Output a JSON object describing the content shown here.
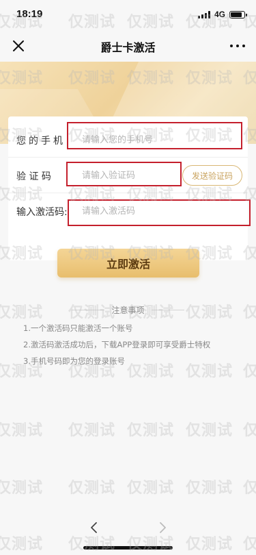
{
  "status_bar": {
    "time": "18:19",
    "network": "4G"
  },
  "nav": {
    "title": "爵士卡激活"
  },
  "form": {
    "phone_label": "您的手机",
    "phone_placeholder": "请输入您的手机号",
    "code_label": "验 证 码",
    "code_placeholder": "请输入验证码",
    "send_code_label": "发送验证码",
    "activation_label": "输入激活码:",
    "activation_placeholder": "请输入激活码"
  },
  "submit_label": "立即激活",
  "notes": {
    "title": "注意事项",
    "items": [
      "1.一个激活码只能激活一个账号",
      "2.激活码激活成功后，下载APP登录即可享受爵士特权",
      "3.手机号码即为您的登录账号"
    ]
  },
  "watermark": {
    "text": "仅测试"
  }
}
